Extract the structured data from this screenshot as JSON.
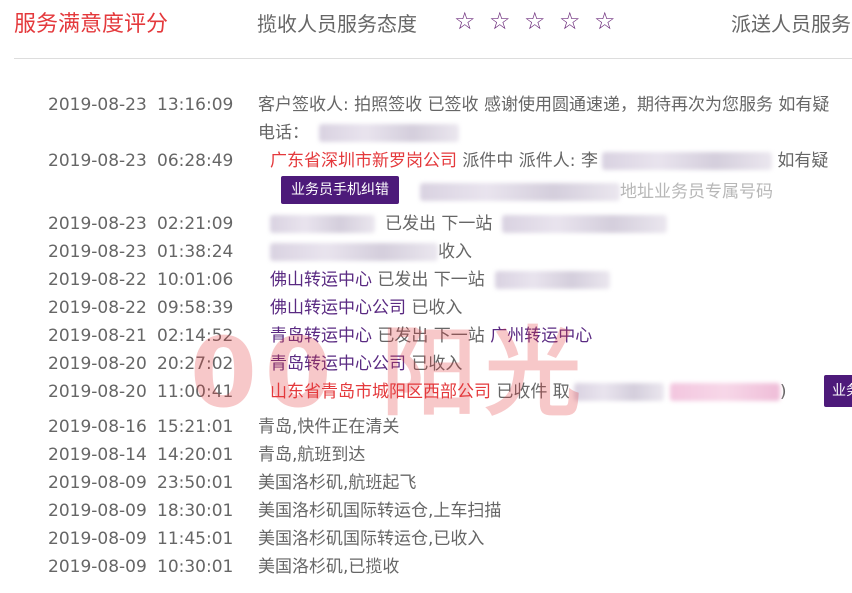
{
  "rating": {
    "title": "服务满意度评分",
    "pickup_label": "揽收人员服务态度",
    "delivery_label": "派送人员服务",
    "stars": [
      "☆",
      "☆",
      "☆",
      "☆",
      "☆"
    ]
  },
  "watermark": "00 阳光",
  "tracking": [
    {
      "date": "2019-08-23",
      "time": "13:16:09",
      "text": "客户签收人: 拍照签收 已签收 感谢使用圆通速递，期待再次为您服务 如有疑",
      "line2": "电话："
    },
    {
      "date": "2019-08-23",
      "time": "06:28:49",
      "link": "广东省深圳市新罗岗公司",
      "text": "派件中 派件人: 李",
      "tail": "如有疑",
      "button": "业务员手机纠错",
      "line2_tail": "地址业务员专属号码"
    },
    {
      "date": "2019-08-23",
      "time": "02:21:09",
      "text": "已发出 下一站"
    },
    {
      "date": "2019-08-23",
      "time": "01:38:24",
      "text": "收入"
    },
    {
      "date": "2019-08-22",
      "time": "10:01:06",
      "link": "佛山转运中心",
      "text": "已发出 下一站"
    },
    {
      "date": "2019-08-22",
      "time": "09:58:39",
      "link": "佛山转运中心公司",
      "text": "已收入"
    },
    {
      "date": "2019-08-21",
      "time": "02:14:52",
      "link": "青岛转运中心",
      "text": "已发出 下一站",
      "link2": "广州转运中心"
    },
    {
      "date": "2019-08-20",
      "time": "20:27:02",
      "link": "青岛转运中心公司",
      "text": "已收入"
    },
    {
      "date": "2019-08-20",
      "time": "11:00:41",
      "link": "山东省青岛市城阳区西部公司",
      "text": "已收件 取",
      "tail": ")",
      "button": "业务"
    },
    {
      "date": "2019-08-16",
      "time": "15:21:01",
      "text": "青岛,快件正在清关"
    },
    {
      "date": "2019-08-14",
      "time": "14:20:01",
      "text": "青岛,航班到达"
    },
    {
      "date": "2019-08-09",
      "time": "23:50:01",
      "text": "美国洛杉矶,航班起飞"
    },
    {
      "date": "2019-08-09",
      "time": "18:30:01",
      "text": "美国洛杉矶国际转运仓,上车扫描"
    },
    {
      "date": "2019-08-09",
      "time": "11:45:01",
      "text": "美国洛杉矶国际转运仓,已收入"
    },
    {
      "date": "2019-08-09",
      "time": "10:30:01",
      "text": "美国洛杉矶,已揽收"
    }
  ]
}
